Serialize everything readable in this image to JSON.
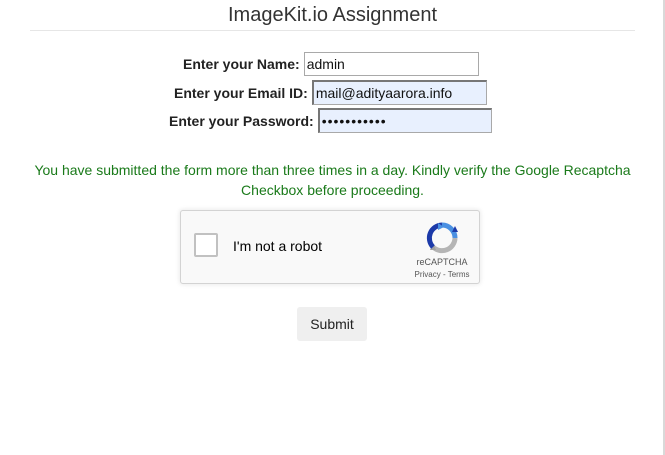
{
  "page": {
    "title": "ImageKit.io Assignment"
  },
  "form": {
    "name_label": "Enter your Name:",
    "name_value": "admin",
    "email_label": "Enter your Email ID:",
    "email_value": "mail@adityaarora.info",
    "password_label": "Enter your Password:",
    "password_value": "secretpass1"
  },
  "notice": {
    "text": "You have submitted the form more than three times in a day. Kindly verify the Google Recaptcha Checkbox before proceeding.",
    "color": "#1a7a1a"
  },
  "captcha": {
    "label": "I'm not a robot",
    "brand": "reCAPTCHA",
    "privacy": "Privacy",
    "separator": " - ",
    "terms": "Terms",
    "icon": "recaptcha-logo-icon"
  },
  "submit": {
    "label": "Submit"
  }
}
